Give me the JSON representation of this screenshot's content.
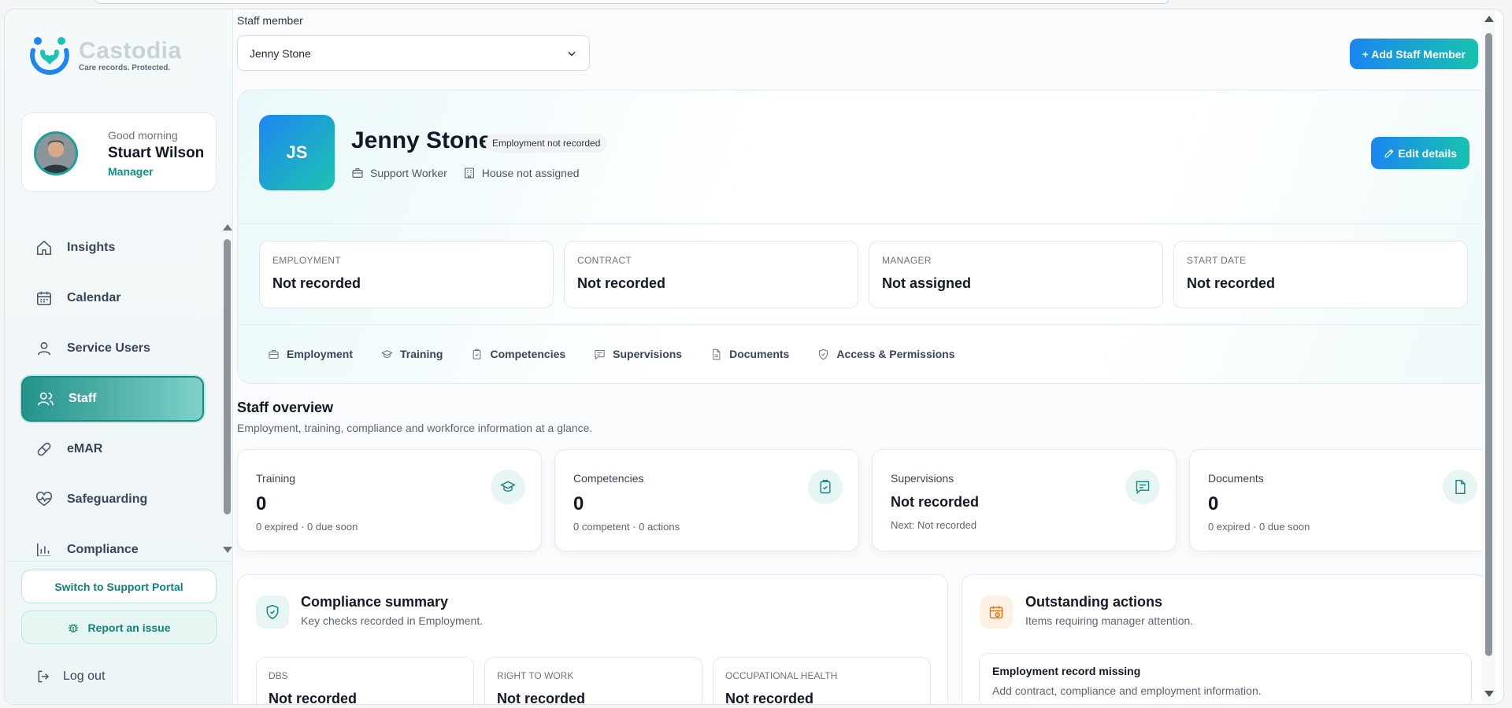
{
  "brand": {
    "name": "Castodia",
    "tagline": "Care records. Protected."
  },
  "user": {
    "greeting": "Good morning",
    "name": "Stuart Wilson",
    "role": "Manager"
  },
  "nav": {
    "items": [
      {
        "label": "Insights",
        "icon": "home-icon"
      },
      {
        "label": "Calendar",
        "icon": "calendar-icon"
      },
      {
        "label": "Service Users",
        "icon": "user-icon"
      },
      {
        "label": "Staff",
        "icon": "users-icon",
        "active": true
      },
      {
        "label": "eMAR",
        "icon": "pill-icon"
      },
      {
        "label": "Safeguarding",
        "icon": "heart-pulse-icon"
      },
      {
        "label": "Compliance",
        "icon": "bar-chart-icon"
      }
    ]
  },
  "sidebar_footer": {
    "switch_portal": "Switch to Support Portal",
    "report_issue": "Report an issue",
    "logout": "Log out"
  },
  "staff_select": {
    "label": "Staff member",
    "value": "Jenny Stone"
  },
  "add_button": "+ Add Staff Member",
  "profile": {
    "initials": "JS",
    "name": "Jenny Stone",
    "badge": "Employment not recorded",
    "role": "Support Worker",
    "house": "House not assigned",
    "edit_label": "Edit details",
    "stats": [
      {
        "key": "EMPLOYMENT",
        "value": "Not recorded"
      },
      {
        "key": "CONTRACT",
        "value": "Not recorded"
      },
      {
        "key": "MANAGER",
        "value": "Not assigned"
      },
      {
        "key": "START DATE",
        "value": "Not recorded"
      }
    ],
    "tabs": [
      {
        "label": "Employment",
        "icon": "briefcase-icon"
      },
      {
        "label": "Training",
        "icon": "graduation-cap-icon"
      },
      {
        "label": "Competencies",
        "icon": "clipboard-check-icon"
      },
      {
        "label": "Supervisions",
        "icon": "message-icon"
      },
      {
        "label": "Documents",
        "icon": "document-icon"
      },
      {
        "label": "Access & Permissions",
        "icon": "shield-icon"
      }
    ]
  },
  "overview": {
    "title": "Staff overview",
    "subtitle": "Employment, training, compliance and workforce information at a glance.",
    "cards": [
      {
        "title": "Training",
        "value": "0",
        "sub": "0 expired · 0 due soon",
        "icon": "graduation-cap-icon"
      },
      {
        "title": "Competencies",
        "value": "0",
        "sub": "0 competent · 0 actions",
        "icon": "clipboard-check-icon"
      },
      {
        "title": "Supervisions",
        "value": "Not recorded",
        "sub": "Next: Not recorded",
        "icon": "message-icon"
      },
      {
        "title": "Documents",
        "value": "0",
        "sub": "0 expired · 0 due soon",
        "icon": "document-icon"
      }
    ]
  },
  "compliance": {
    "title": "Compliance summary",
    "subtitle": "Key checks recorded in Employment.",
    "items": [
      {
        "key": "DBS",
        "value": "Not recorded"
      },
      {
        "key": "RIGHT TO WORK",
        "value": "Not recorded"
      },
      {
        "key": "OCCUPATIONAL HEALTH",
        "value": "Not recorded"
      }
    ]
  },
  "outstanding": {
    "title": "Outstanding actions",
    "subtitle": "Items requiring manager attention.",
    "items": [
      {
        "title": "Employment record missing",
        "desc": "Add contract, compliance and employment information."
      }
    ]
  },
  "colors": {
    "accent": "#1aa39a",
    "primary_gradient_start": "#1a86f0",
    "primary_gradient_end": "#19c2b0",
    "warning": "#e07a1f"
  }
}
